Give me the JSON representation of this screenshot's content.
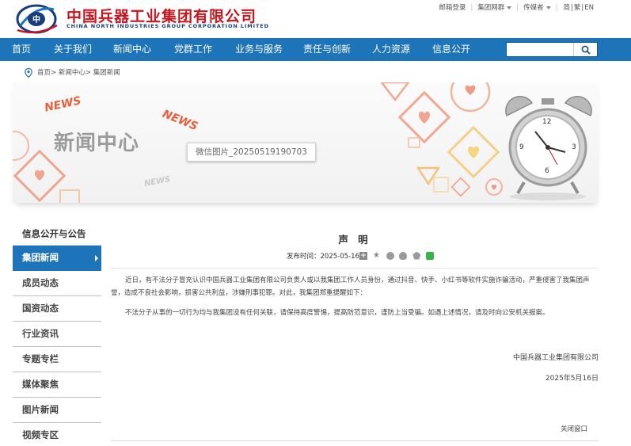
{
  "header": {
    "logo_cn": "中国兵器工业集团有限公司",
    "logo_en": "CHINA NORTH INDUSTRIES GROUP CORPORATION LIMITED",
    "top_links": {
      "mail_login": "邮箱登录",
      "group_network": "集团网群",
      "media": "传媒者",
      "lang_simplified": "简",
      "lang_traditional": "繁",
      "lang_english": "EN"
    }
  },
  "nav": {
    "items": [
      "首页",
      "关于我们",
      "新闻中心",
      "党群工作",
      "业务与服务",
      "责任与创新",
      "人力资源",
      "信息公开"
    ],
    "search_value": "",
    "search_icon": "search-icon"
  },
  "breadcrumb": {
    "home": "首页",
    "news_center": "新闻中心",
    "group_news": "集团新闻"
  },
  "banner": {
    "title": "新闻中心",
    "news_a": "NEWS",
    "news_b": "NEWS",
    "news_c": "NEWS",
    "clock_numbers": [
      "12",
      "3",
      "6",
      "9"
    ],
    "image_caption": "微信图片_20250519190703"
  },
  "sidebar": {
    "heading": "信息公开与公告",
    "items": [
      "集团新闻",
      "成员动态",
      "国资动态",
      "行业资讯",
      "专题专栏",
      "媒体聚焦",
      "图片新闻",
      "视频专区"
    ],
    "active_index": 0
  },
  "article": {
    "title": "声 明",
    "publish_label": "发布时间：",
    "publish_date": "2025-05-16",
    "share_icons": [
      "plus-share-icon",
      "star-icon",
      "weibo-icon",
      "qq-icon",
      "qzone-icon",
      "wechat-icon"
    ],
    "paragraph_1": "近日，有不法分子冒充认识中国兵器工业集团有限公司负责人或以我集团工作人员身份，通过抖音、快手、小红书等软件实施诈骗活动，严重侵害了我集团声誉，造成不良社会影响，损害公共利益，涉嫌刑事犯罪。对此，我集团郑重提醒如下：",
    "paragraph_2": "不法分子从事的一切行为均与我集团没有任何关联，请保持高度警惕，提高防范意识，谨防上当受骗。如遇上述情况，请及时向公安机关报案。",
    "signature": "中国兵器工业集团有限公司",
    "sign_date": "2025年5月16日",
    "close_window": "关闭窗口"
  },
  "colors": {
    "brand_blue": "#1d74b8",
    "brand_red": "#c6161f"
  }
}
